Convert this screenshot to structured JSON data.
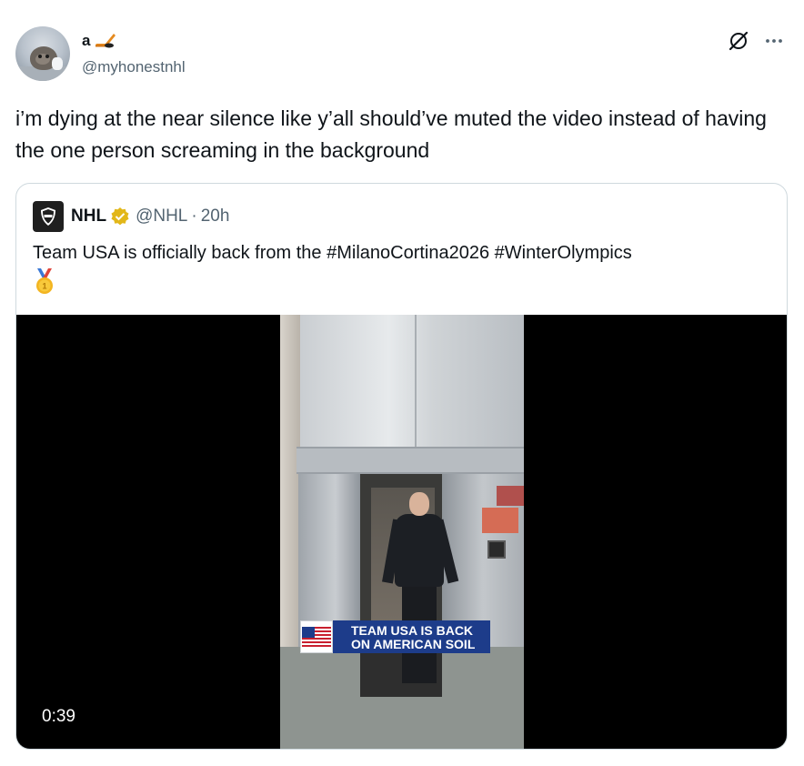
{
  "author": {
    "display_name": "a",
    "handle": "@myhonestnhl",
    "name_emoji": "hockey-stick-icon"
  },
  "tweet": {
    "text": "i’m dying at the near silence like y’all should’ve muted the video instead of having the one person screaming in the background"
  },
  "quoted": {
    "name": "NHL",
    "handle": "@NHL",
    "separator": "·",
    "time": "20h",
    "text": "Team USA is officially back from the #MilanoCortina2026 #WinterOlympics",
    "emoji": "1st-place-medal-icon",
    "verified_color": "#e2b719"
  },
  "video": {
    "banner_line1": "TEAM USA IS BACK",
    "banner_line2": "ON AMERICAN SOIL",
    "duration": "0:39"
  },
  "colors": {
    "text_primary": "#0f1419",
    "text_secondary": "#536471",
    "border": "#cfd9de",
    "banner_blue": "#1d3c8a"
  }
}
